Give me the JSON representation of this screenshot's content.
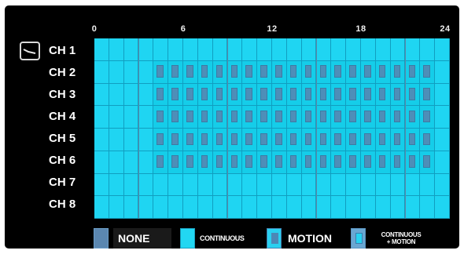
{
  "schedule": {
    "hour_labels": [
      "0",
      "6",
      "12",
      "18",
      "24"
    ],
    "hours_per_day": 24,
    "channels": [
      {
        "label": "CH 1",
        "modes": [
          "continuous",
          "continuous",
          "continuous",
          "continuous",
          "continuous",
          "continuous",
          "continuous",
          "continuous",
          "continuous",
          "continuous",
          "continuous",
          "continuous",
          "continuous",
          "continuous",
          "continuous",
          "continuous",
          "continuous",
          "continuous",
          "continuous",
          "continuous",
          "continuous",
          "continuous",
          "continuous",
          "continuous"
        ]
      },
      {
        "label": "CH 2",
        "modes": [
          "continuous",
          "continuous",
          "continuous",
          "continuous",
          "motion",
          "motion",
          "motion",
          "motion",
          "motion",
          "motion",
          "motion",
          "motion",
          "motion",
          "motion",
          "motion",
          "motion",
          "motion",
          "motion",
          "motion",
          "motion",
          "motion",
          "motion",
          "motion",
          "continuous"
        ]
      },
      {
        "label": "CH 3",
        "modes": [
          "continuous",
          "continuous",
          "continuous",
          "continuous",
          "motion",
          "motion",
          "motion",
          "motion",
          "motion",
          "motion",
          "motion",
          "motion",
          "motion",
          "motion",
          "motion",
          "motion",
          "motion",
          "motion",
          "motion",
          "motion",
          "motion",
          "motion",
          "motion",
          "continuous"
        ]
      },
      {
        "label": "CH 4",
        "modes": [
          "continuous",
          "continuous",
          "continuous",
          "continuous",
          "motion",
          "motion",
          "motion",
          "motion",
          "motion",
          "motion",
          "motion",
          "motion",
          "motion",
          "motion",
          "motion",
          "motion",
          "motion",
          "motion",
          "motion",
          "motion",
          "motion",
          "motion",
          "motion",
          "continuous"
        ]
      },
      {
        "label": "CH 5",
        "modes": [
          "continuous",
          "continuous",
          "continuous",
          "continuous",
          "motion",
          "motion",
          "motion",
          "motion",
          "motion",
          "motion",
          "motion",
          "motion",
          "motion",
          "motion",
          "motion",
          "motion",
          "motion",
          "motion",
          "motion",
          "motion",
          "motion",
          "motion",
          "motion",
          "continuous"
        ]
      },
      {
        "label": "CH 6",
        "modes": [
          "continuous",
          "continuous",
          "continuous",
          "continuous",
          "motion",
          "motion",
          "motion",
          "motion",
          "motion",
          "motion",
          "motion",
          "motion",
          "motion",
          "motion",
          "motion",
          "motion",
          "motion",
          "motion",
          "motion",
          "motion",
          "motion",
          "motion",
          "motion",
          "continuous"
        ]
      },
      {
        "label": "CH 7",
        "modes": [
          "continuous",
          "continuous",
          "continuous",
          "continuous",
          "continuous",
          "continuous",
          "continuous",
          "continuous",
          "continuous",
          "continuous",
          "continuous",
          "continuous",
          "continuous",
          "continuous",
          "continuous",
          "continuous",
          "continuous",
          "continuous",
          "continuous",
          "continuous",
          "continuous",
          "continuous",
          "continuous",
          "continuous"
        ]
      },
      {
        "label": "CH 8",
        "modes": [
          "continuous",
          "continuous",
          "continuous",
          "continuous",
          "continuous",
          "continuous",
          "continuous",
          "continuous",
          "continuous",
          "continuous",
          "continuous",
          "continuous",
          "continuous",
          "continuous",
          "continuous",
          "continuous",
          "continuous",
          "continuous",
          "continuous",
          "continuous",
          "continuous",
          "continuous",
          "continuous",
          "continuous"
        ]
      }
    ]
  },
  "selector": {
    "icon": "check-mark-icon",
    "selected_channel": "CH 1"
  },
  "legend": {
    "none": "NONE",
    "continuous": "CONTINUOUS",
    "motion": "MOTION",
    "continuous_motion_line1": "CONTINUOUS",
    "continuous_motion_line2": "+ MOTION"
  },
  "colors": {
    "none": "#5b87b0",
    "continuous": "#1fd5f2",
    "motion_marker": "#4e8eb8",
    "grid_line": "#119ec0",
    "background": "#000000",
    "text": "#ffffff"
  }
}
